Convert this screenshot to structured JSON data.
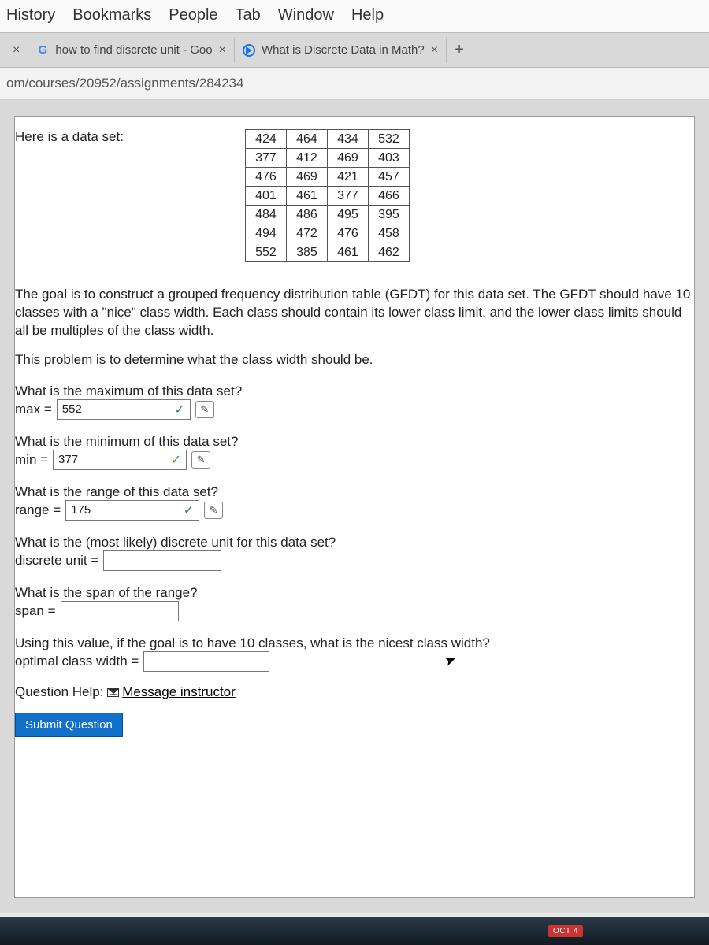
{
  "menubar": [
    "History",
    "Bookmarks",
    "People",
    "Tab",
    "Window",
    "Help"
  ],
  "tabs": {
    "left_close": "×",
    "tab1": {
      "label": "how to find discrete unit - Goo",
      "close": "×"
    },
    "tab2": {
      "label": "What is Discrete Data in Math?",
      "close": "×"
    },
    "new": "+"
  },
  "url": "om/courses/20952/assignments/284234",
  "intro_label": "Here is a data set:",
  "data_rows": [
    [
      424,
      464,
      434,
      532
    ],
    [
      377,
      412,
      469,
      403
    ],
    [
      476,
      469,
      421,
      457
    ],
    [
      401,
      461,
      377,
      466
    ],
    [
      484,
      486,
      495,
      395
    ],
    [
      494,
      472,
      476,
      458
    ],
    [
      552,
      385,
      461,
      462
    ]
  ],
  "para1": "The goal is to construct a grouped frequency distribution table (GFDT) for this data set. The GFDT should have 10 classes with a \"nice\" class width. Each class should contain its lower class limit, and the lower class limits should all be multiples of the class width.",
  "para2": "This problem is to determine what the class width should be.",
  "q_max": {
    "prompt": "What is the maximum of this data set?",
    "label": "max =",
    "value": "552"
  },
  "q_min": {
    "prompt": "What is the minimum of this data set?",
    "label": "min =",
    "value": "377"
  },
  "q_range": {
    "prompt": "What is the range of this data set?",
    "label": "range =",
    "value": "175"
  },
  "q_unit": {
    "prompt": "What is the (most likely) discrete unit for this data set?",
    "label": "discrete unit ="
  },
  "q_span": {
    "prompt": "What is the span of the range?",
    "label": "span ="
  },
  "q_width": {
    "prompt": "Using this value, if the goal is to have 10 classes, what is the nicest class width?",
    "label": "optimal class width ="
  },
  "help_label": "Question Help:",
  "help_link": "Message instructor",
  "submit_label": "Submit Question",
  "check_glyph": "✓",
  "wand_glyph": "✎",
  "calendar": {
    "month": "OCT",
    "day": "4"
  }
}
